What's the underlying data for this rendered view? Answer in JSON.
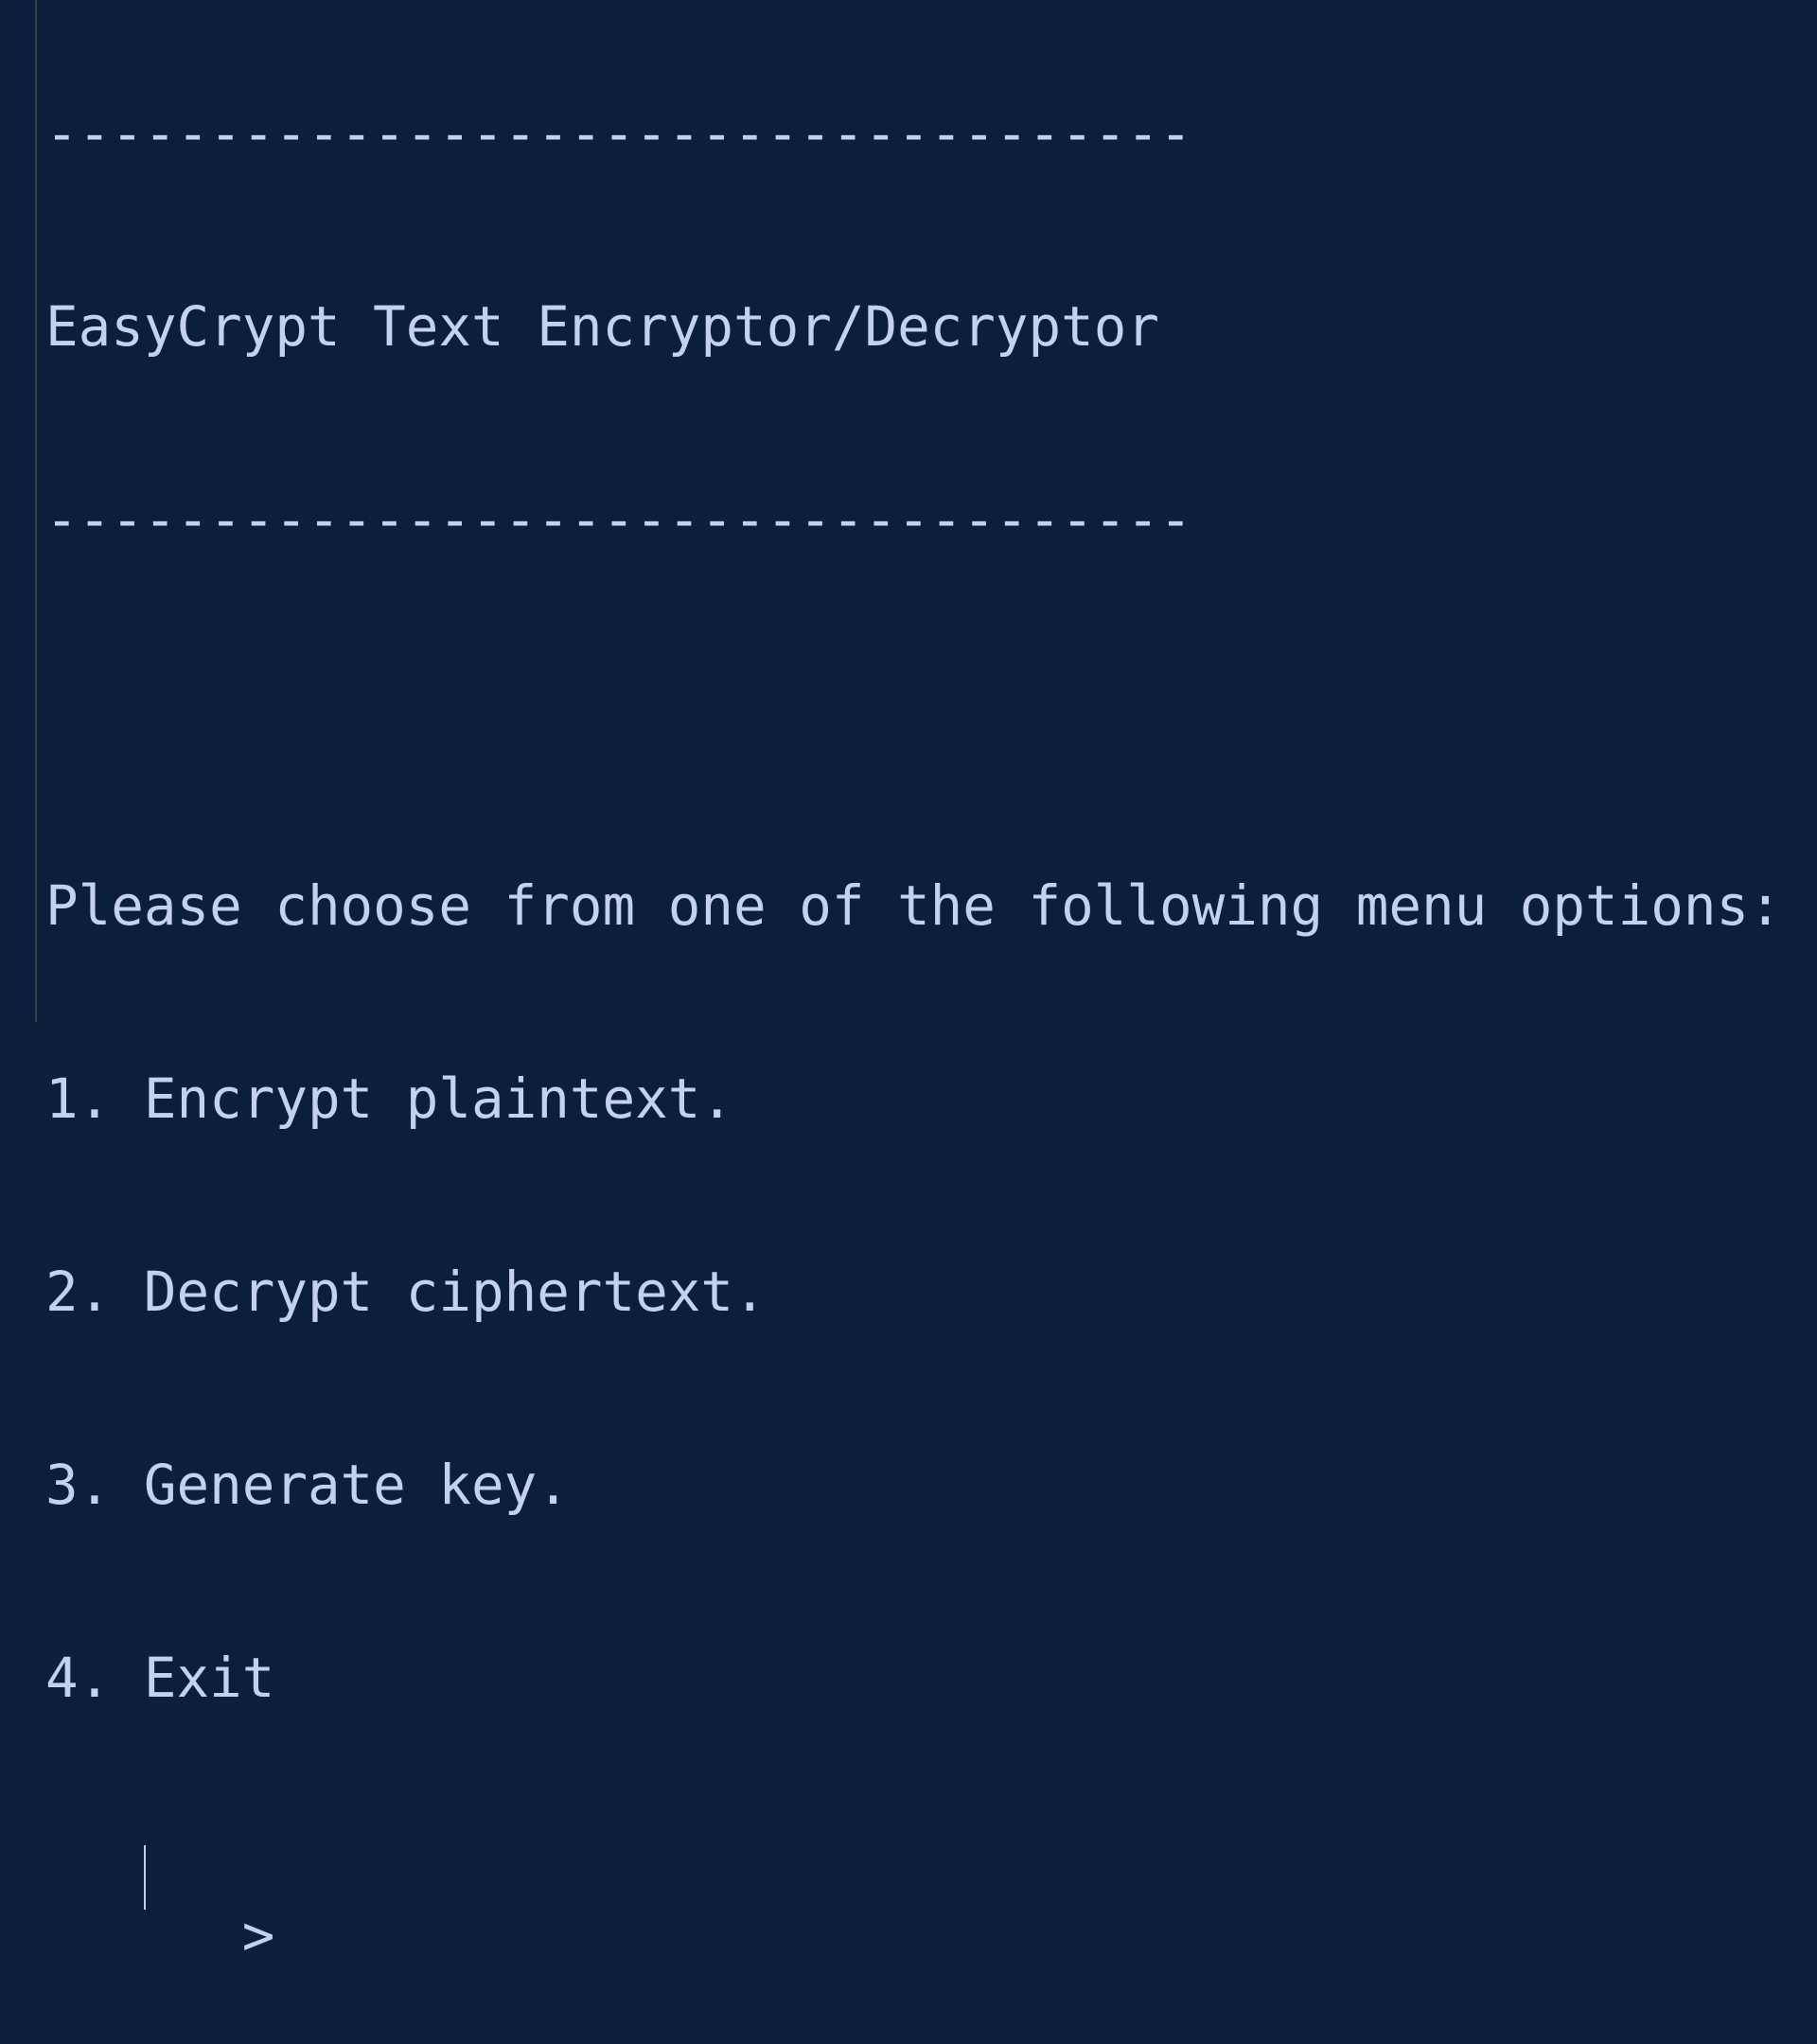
{
  "terminal": {
    "separator_top": "-----------------------------------",
    "title": "EasyCrypt Text Encryptor/Decryptor",
    "separator_bottom": "-----------------------------------",
    "menu_prompt": "Please choose from one of the following menu options:",
    "options": [
      "1. Encrypt plaintext.",
      "2. Decrypt ciphertext.",
      "3. Generate key.",
      "4. Exit"
    ],
    "input_prompt": ">",
    "input_value": ""
  },
  "colors": {
    "background": "#0b1f3a",
    "text": "#c4d0f2",
    "border": "#3a3f46"
  }
}
